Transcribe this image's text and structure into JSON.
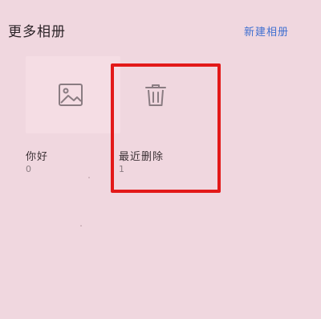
{
  "header": {
    "title": "更多相册",
    "new_album_label": "新建相册"
  },
  "albums": [
    {
      "name": "你好",
      "count": "0",
      "icon": "image-icon"
    },
    {
      "name": "最近删除",
      "count": "1",
      "icon": "trash-icon"
    }
  ],
  "colors": {
    "background": "#f0d7df",
    "accent": "#3f6fd0",
    "highlight": "#e31919"
  }
}
